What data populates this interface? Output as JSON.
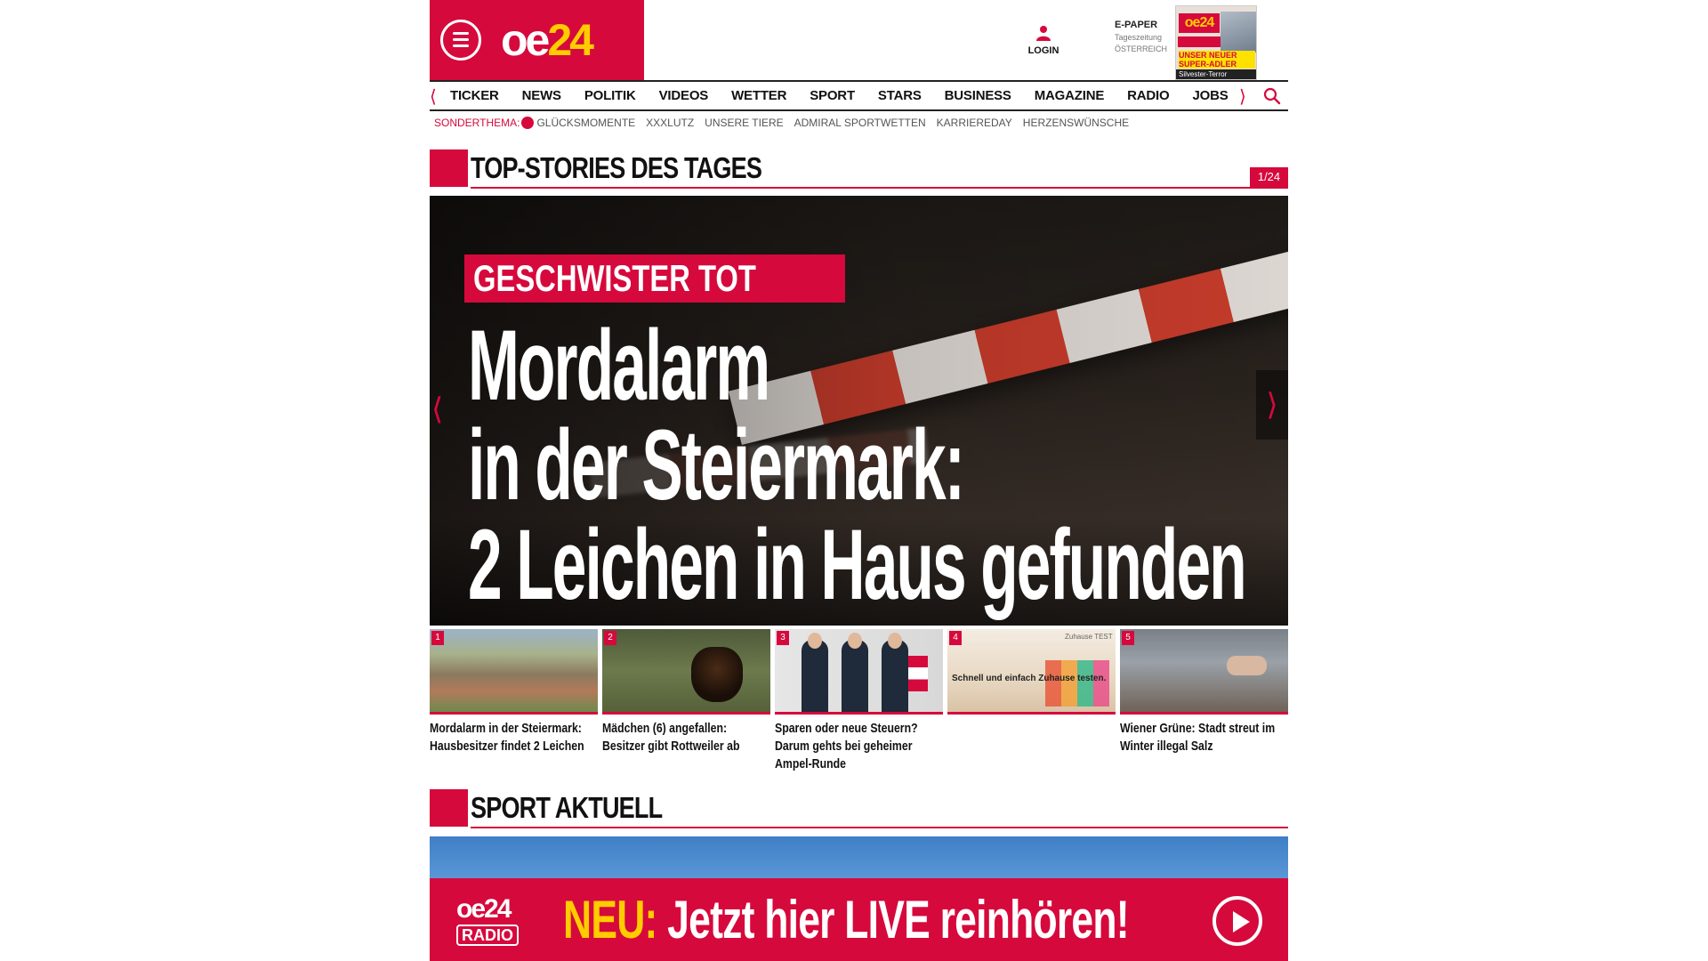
{
  "brand": {
    "logo_oe": "oe",
    "logo_24": "24",
    "accent": "#d6093c",
    "yellow": "#ffcc00"
  },
  "header": {
    "login_label": "LOGIN",
    "epaper_title": "E-PAPER",
    "epaper_sub": "Tageszeitung",
    "epaper_country": "ÖSTERREICH",
    "cover_logo": "oe24",
    "cover_headline": "UNSER NEUER SUPER-ADLER",
    "cover_bottom": "Silvester-Terror"
  },
  "nav": {
    "items": [
      "TICKER",
      "NEWS",
      "POLITIK",
      "VIDEOS",
      "WETTER",
      "SPORT",
      "STARS",
      "BUSINESS",
      "MAGAZINE",
      "RADIO",
      "JOBS"
    ]
  },
  "subnav": {
    "label": "SONDERTHEMA:",
    "items": [
      "GLÜCKSMOMENTE",
      "XXXLUTZ",
      "UNSERE TIERE",
      "ADMIRAL SPORTWETTEN",
      "KARRIEREDAY",
      "HERZENSWÜNSCHE"
    ]
  },
  "top_stories": {
    "title": "TOP-STORIES DES TAGES",
    "counter": "1/24",
    "hero": {
      "kicker": "GESCHWISTER TOT",
      "lines": [
        "Mordalarm",
        "in der Steiermark:",
        "2 Leichen in Haus gefunden"
      ]
    },
    "teasers": [
      {
        "num": "1",
        "title": "Mordalarm in der Steiermark: Hausbesitzer findet 2 Leichen"
      },
      {
        "num": "2",
        "title": "Mädchen (6) angefallen: Besitzer gibt Rottweiler ab"
      },
      {
        "num": "3",
        "title": "Sparen oder neue Steuern? Darum gehts bei geheimer Ampel-Runde"
      },
      {
        "num": "4",
        "title": "",
        "ad_text": "Schnell und einfach Zuhause testen.",
        "ad_tag": "Zuhause TEST"
      },
      {
        "num": "5",
        "title": "Wiener Grüne: Stadt streut im Winter illegal Salz"
      }
    ]
  },
  "sport": {
    "title": "SPORT AKTUELL"
  },
  "radio_banner": {
    "logo_top": "oe24",
    "logo_radio": "RADIO",
    "neu": "NEU:",
    "message": "Jetzt hier LIVE reinhören!"
  }
}
